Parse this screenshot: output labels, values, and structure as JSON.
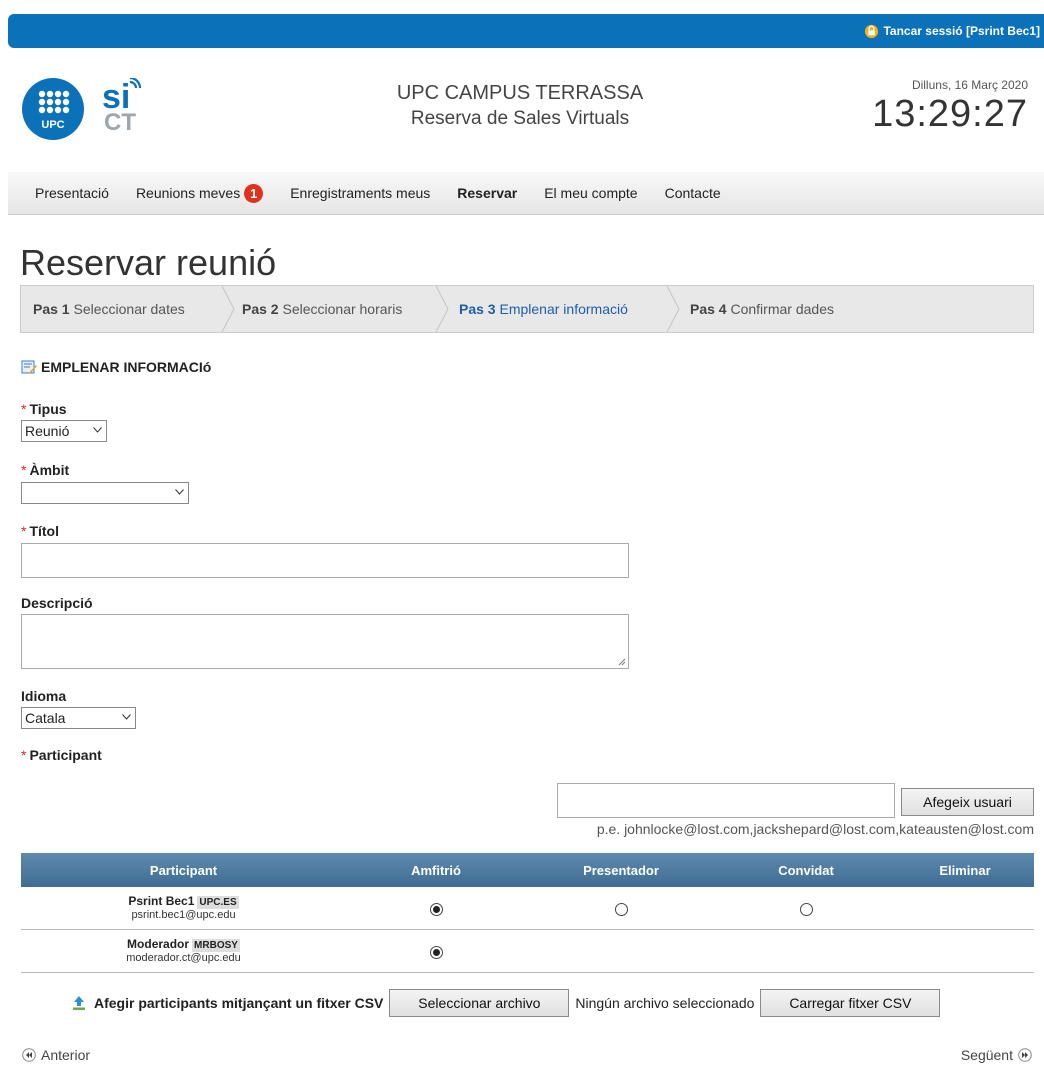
{
  "topbar": {
    "logout_label": "Tancar sessió [Psrint Bec1]"
  },
  "header": {
    "upc_logo_text": "UPC",
    "sict_logo_text": "CT",
    "org_line1": "UPC CAMPUS TERRASSA",
    "org_line2": "Reserva de Sales Virtuals",
    "date": "Dilluns, 16 Març 2020",
    "time": "13:29:27"
  },
  "nav": {
    "items": [
      "Presentació",
      "Reunions meves",
      "Enregistraments meus",
      "Reservar",
      "El meu compte",
      "Contacte"
    ],
    "badge_count": "1"
  },
  "page": {
    "title": "Reservar reunió"
  },
  "steps": [
    {
      "num": "Pas 1",
      "label": "Seleccionar dates"
    },
    {
      "num": "Pas 2",
      "label": "Seleccionar horaris"
    },
    {
      "num": "Pas 3",
      "label": "Emplenar informació"
    },
    {
      "num": "Pas 4",
      "label": "Confirmar dades"
    }
  ],
  "form": {
    "section_title": "EMPLENAR INFORMACIó",
    "tipus_label": "Tipus",
    "tipus_value": "Reunió",
    "ambit_label": "Àmbit",
    "ambit_value": "",
    "titol_label": "Títol",
    "titol_value": "",
    "descripcio_label": "Descripció",
    "descripcio_value": "",
    "idioma_label": "Idioma",
    "idioma_value": "Catala",
    "participant_label": "Participant",
    "required_mark": "*",
    "add_user_input_value": "",
    "add_user_button": "Afegeix usuari",
    "hint": "p.e. johnlocke@lost.com,jackshepard@lost.com,kateausten@lost.com"
  },
  "table": {
    "headers": [
      "Participant",
      "Amfitrió",
      "Presentador",
      "Convidat",
      "Eliminar"
    ],
    "rows": [
      {
        "name": "Psrint Bec1",
        "tag": "UPC.ES",
        "email": "psrint.bec1@upc.edu",
        "role": "Amfitrió"
      },
      {
        "name": "Moderador",
        "tag": "MRBOSY",
        "email": "moderador.ct@upc.edu",
        "role": "Amfitrió"
      }
    ]
  },
  "csv": {
    "label": "Afegir participants mitjançant un fitxer CSV",
    "select_button": "Seleccionar archivo",
    "no_file": "Ningún archivo seleccionado",
    "upload_button": "Carregar fitxer CSV"
  },
  "footer": {
    "prev": "Anterior",
    "next": "Següent"
  },
  "colors": {
    "topbar": "#0b71b9",
    "table_header": "#4a769c",
    "active_step": "#1d5fa6",
    "badge": "#e0311d"
  }
}
